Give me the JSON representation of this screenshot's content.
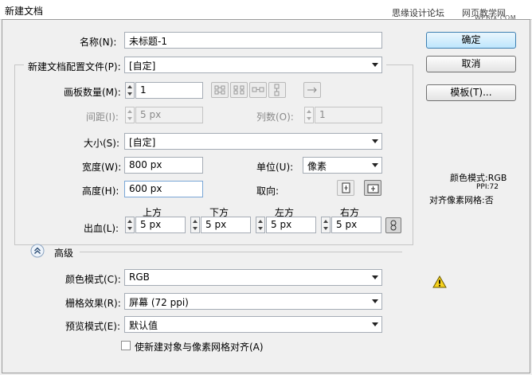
{
  "window": {
    "title": "新建文档",
    "watermark_left": "思缘设计论坛",
    "watermark_right": "网页教学网",
    "watermark_url": "WEBJX.COM"
  },
  "form": {
    "name_label": "名称(N):",
    "name_value": "未标题-1",
    "profile_label": "新建文档配置文件(P):",
    "profile_value": "[自定]",
    "artboards_label": "画板数量(M):",
    "artboards_value": "1",
    "spacing_label": "间距(I):",
    "spacing_value": "5 px",
    "columns_label": "列数(O):",
    "columns_value": "1",
    "size_label": "大小(S):",
    "size_value": "[自定]",
    "width_label": "宽度(W):",
    "width_value": "800 px",
    "units_label": "单位(U):",
    "units_value": "像素",
    "height_label": "高度(H):",
    "height_value": "600 px",
    "orientation_label": "取向:",
    "bleed_label": "出血(L):",
    "bleed": {
      "top_label": "上方",
      "top_value": "5 px",
      "bottom_label": "下方",
      "bottom_value": "5 px",
      "left_label": "左方",
      "left_value": "5 px",
      "right_label": "右方",
      "right_value": "5 px"
    },
    "advanced_label": "高级",
    "color_mode_label": "颜色模式(C):",
    "color_mode_value": "RGB",
    "raster_label": "栅格效果(R):",
    "raster_value": "屏幕 (72 ppi)",
    "preview_label": "预览模式(E):",
    "preview_value": "默认值",
    "align_label": "使新建对象与像素网格对齐(A)"
  },
  "buttons": {
    "ok": "确定",
    "cancel": "取消",
    "templates": "模板(T)..."
  },
  "info": {
    "color_mode": "颜色模式:RGB",
    "ppi": "PPI:72",
    "pixel_grid": "对齐像素网格:否"
  }
}
